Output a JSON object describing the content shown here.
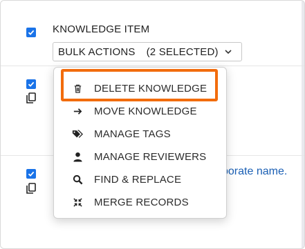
{
  "header": {
    "title": "KNOWLEDGE ITEM"
  },
  "bulk_actions": {
    "label": "BULK ACTIONS",
    "selected_count": "(2 SELECTED)",
    "icon": "chevron-down-icon"
  },
  "rows": [
    {
      "checked": true,
      "icon": "copy-icon"
    },
    {
      "checked": true,
      "icon": "copy-icon",
      "partial_text": "porate name."
    }
  ],
  "menu": {
    "items": [
      {
        "label": "DELETE KNOWLEDGE",
        "icon": "trash-icon"
      },
      {
        "label": "MOVE KNOWLEDGE",
        "icon": "arrow-right-icon"
      },
      {
        "label": "MANAGE TAGS",
        "icon": "tags-icon"
      },
      {
        "label": "MANAGE REVIEWERS",
        "icon": "user-icon"
      },
      {
        "label": "FIND & REPLACE",
        "icon": "search-icon"
      },
      {
        "label": "MERGE RECORDS",
        "icon": "merge-icon"
      }
    ]
  },
  "colors": {
    "checkbox": "#1a73e8",
    "highlight": "#f26c0d",
    "link": "#1a5fb4"
  }
}
